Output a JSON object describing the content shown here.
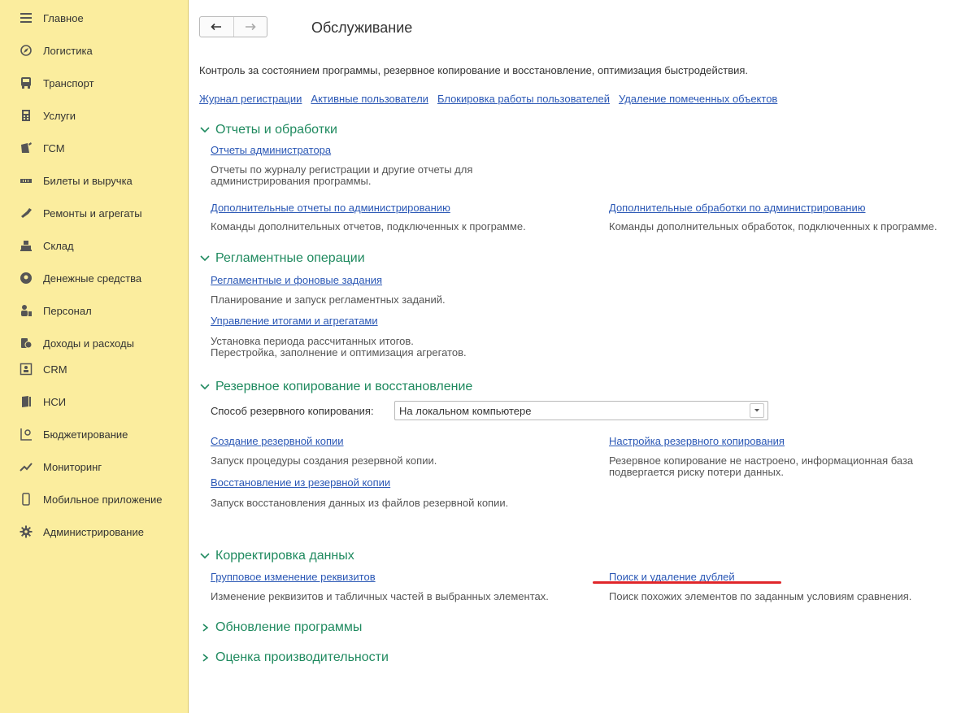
{
  "sidebar": {
    "items": [
      {
        "label": "Главное",
        "icon": "menu-icon"
      },
      {
        "label": "Логистика",
        "icon": "compass-icon"
      },
      {
        "label": "Транспорт",
        "icon": "bus-icon"
      },
      {
        "label": "Услуги",
        "icon": "calculator-icon"
      },
      {
        "label": "ГСМ",
        "icon": "fuel-icon"
      },
      {
        "label": "Билеты и выручка",
        "icon": "ticket-icon"
      },
      {
        "label": "Ремонты и агрегаты",
        "icon": "wrench-icon"
      },
      {
        "label": "Склад",
        "icon": "warehouse-icon"
      },
      {
        "label": "Денежные средства",
        "icon": "money-icon"
      },
      {
        "label": "Персонал",
        "icon": "person-icon"
      },
      {
        "label": "Доходы и расходы",
        "icon": "coins-icon"
      },
      {
        "label": "CRM",
        "icon": "crm-icon"
      },
      {
        "label": "НСИ",
        "icon": "book-icon"
      },
      {
        "label": "Бюджетирование",
        "icon": "budget-icon"
      },
      {
        "label": "Мониторинг",
        "icon": "monitoring-icon"
      },
      {
        "label": "Мобильное приложение",
        "icon": "mobile-icon"
      },
      {
        "label": "Администрирование",
        "icon": "gear-icon"
      }
    ]
  },
  "page": {
    "title": "Обслуживание",
    "description": "Контроль за состоянием программы, резервное копирование и восстановление, оптимизация быстродействия."
  },
  "quick_links": [
    "Журнал регистрации",
    "Активные пользователи",
    "Блокировка работы пользователей",
    "Удаление помеченных объектов"
  ],
  "sections": {
    "reports": {
      "title": "Отчеты и обработки",
      "admin_reports": {
        "link": "Отчеты администратора",
        "desc1": "Отчеты по журналу регистрации и другие отчеты для",
        "desc2": "администрирования программы."
      },
      "extra_reports": {
        "link": "Дополнительные отчеты по администрированию",
        "desc": "Команды дополнительных отчетов, подключенных к программе."
      },
      "extra_processing": {
        "link": "Дополнительные обработки по администрированию",
        "desc": "Команды дополнительных обработок, подключенных к программе."
      }
    },
    "scheduled": {
      "title": "Регламентные операции",
      "jobs": {
        "link": "Регламентные и фоновые задания",
        "desc": "Планирование и запуск регламентных заданий."
      },
      "totals": {
        "link": "Управление итогами и агрегатами",
        "desc1": "Установка периода рассчитанных итогов.",
        "desc2": "Перестройка, заполнение и оптимизация агрегатов."
      }
    },
    "backup": {
      "title": "Резервное копирование и восстановление",
      "method_label": "Способ резервного копирования:",
      "method_value": "На локальном компьютере",
      "create": {
        "link": "Создание резервной копии",
        "desc": "Запуск процедуры создания резервной копии."
      },
      "restore": {
        "link": "Восстановление из резервной копии",
        "desc": "Запуск восстановления данных из файлов резервной копии."
      },
      "settings": {
        "link": "Настройка резервного копирования",
        "desc1": "Резервное копирование не настроено, информационная база",
        "desc2": "подвергается риску потери данных."
      }
    },
    "correction": {
      "title": "Корректировка данных",
      "group_edit": {
        "link": "Групповое изменение реквизитов",
        "desc": "Изменение реквизитов и табличных частей в выбранных элементах."
      },
      "duplicates": {
        "link": "Поиск и удаление дублей",
        "desc": "Поиск похожих элементов по заданным условиям сравнения."
      }
    },
    "update": {
      "title": "Обновление программы"
    },
    "performance": {
      "title": "Оценка производительности"
    }
  },
  "colors": {
    "sidebar_bg": "#fbed9e",
    "link": "#2a57b5",
    "section_header": "#1f8a5f",
    "highlight": "#e0262a"
  }
}
